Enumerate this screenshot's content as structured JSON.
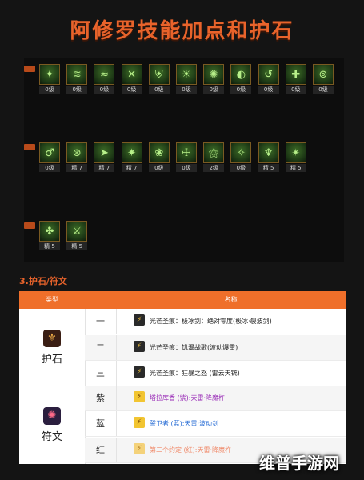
{
  "title": "阿修罗技能加点和护石",
  "skill_rows": [
    {
      "skills": [
        {
          "icon": "leaf-icon",
          "glyph": "✦",
          "level": "0级"
        },
        {
          "icon": "claw-icon",
          "glyph": "≋",
          "level": "0级"
        },
        {
          "icon": "wave-icon",
          "glyph": "≈",
          "level": "0级"
        },
        {
          "icon": "slash-icon",
          "glyph": "✕",
          "level": "0级"
        },
        {
          "icon": "shield-icon",
          "glyph": "⛨",
          "level": "0级"
        },
        {
          "icon": "flame-icon",
          "glyph": "☀",
          "level": "0级"
        },
        {
          "icon": "crest-icon",
          "glyph": "✺",
          "level": "0级"
        },
        {
          "icon": "orb-icon",
          "glyph": "◐",
          "level": "0级"
        },
        {
          "icon": "swirl-icon",
          "glyph": "↺",
          "level": "0级"
        },
        {
          "icon": "cross-icon",
          "glyph": "✚",
          "level": "0级"
        },
        {
          "icon": "ring-icon",
          "glyph": "⊚",
          "level": "0级"
        }
      ]
    },
    {
      "skills": [
        {
          "icon": "figure-icon",
          "glyph": "♂",
          "level": "0级"
        },
        {
          "icon": "seal-icon",
          "glyph": "⊛",
          "level": "精 7"
        },
        {
          "icon": "arrow-icon",
          "glyph": "➤",
          "level": "精 7"
        },
        {
          "icon": "burst-icon",
          "glyph": "✷",
          "level": "精 7"
        },
        {
          "icon": "lotus-icon",
          "glyph": "❀",
          "level": "0级"
        },
        {
          "icon": "pillar-icon",
          "glyph": "☩",
          "level": "0级"
        },
        {
          "icon": "sigil-icon",
          "glyph": "⚝",
          "level": "2级"
        },
        {
          "icon": "spark-icon",
          "glyph": "✧",
          "level": "0级"
        },
        {
          "icon": "warrior-icon",
          "glyph": "♆",
          "level": "精 5"
        },
        {
          "icon": "star-icon",
          "glyph": "✴",
          "level": "精 5"
        }
      ]
    },
    {
      "skills": [
        {
          "icon": "rune-icon",
          "glyph": "✤",
          "level": "精 5"
        },
        {
          "icon": "blade-icon",
          "glyph": "⚔",
          "level": "精 5"
        }
      ]
    }
  ],
  "section_title": "3.护石/符文",
  "table": {
    "header": {
      "type": "类型",
      "name": "名称"
    },
    "categories": [
      {
        "label": "护石",
        "badge_glyph": "⚜",
        "badge_color": "#3a1e14",
        "badge_fg": "#f2b04a"
      },
      {
        "label": "符文",
        "badge_glyph": "✺",
        "badge_color": "#2b1f3f",
        "badge_fg": "#ff6b8a"
      }
    ],
    "rows": [
      {
        "tier": "一",
        "gem_glyph": "⚡",
        "gem_color": "#2a2a2a",
        "gem_fg": "#f3c23a",
        "text": "光芒圣痕：极冰剑：绝对零度(极冰·裂波剑)",
        "color": "#222222"
      },
      {
        "tier": "二",
        "gem_glyph": "⚡",
        "gem_color": "#2a2a2a",
        "gem_fg": "#f3c23a",
        "text": "光芒圣痕：饥渴战歌(波动爆雷)",
        "color": "#222222"
      },
      {
        "tier": "三",
        "gem_glyph": "⚡",
        "gem_color": "#2a2a2a",
        "gem_fg": "#f3c23a",
        "text": "光芒圣痕：狂暴之怒 (雷云天铳)",
        "color": "#222222"
      },
      {
        "tier": "紫",
        "gem_glyph": "⚡",
        "gem_color": "#f2c531",
        "gem_fg": "#6b3a00",
        "text": "塔拉库香 (紫):天雷·降魔杵",
        "color": "#9b2fb8"
      },
      {
        "tier": "蓝",
        "gem_glyph": "⚡",
        "gem_color": "#f2c531",
        "gem_fg": "#6b3a00",
        "text": "誓卫者 (蓝):天雷·波动剑",
        "color": "#2b6fd6"
      },
      {
        "tier": "红",
        "gem_glyph": "⚡",
        "gem_color": "#f4d27a",
        "gem_fg": "#b07a20",
        "text": "第二个约定 (红):天雷·降魔杵",
        "color": "#f08a6a"
      }
    ]
  },
  "watermark": "维普手游网"
}
